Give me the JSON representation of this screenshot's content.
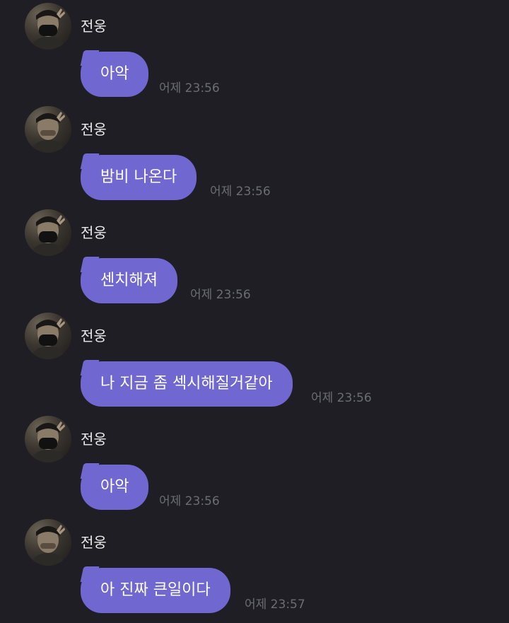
{
  "colors": {
    "background": "#1e1e24",
    "bubble": "#7068d0",
    "bubble_text": "#ffffff",
    "sender_text": "#ececec",
    "timestamp_text": "#6c6c74"
  },
  "messages": [
    {
      "sender": "전웅",
      "text": "아악",
      "time": "어제 23:56"
    },
    {
      "sender": "전웅",
      "text": "밤비 나온다",
      "time": "어제 23:56"
    },
    {
      "sender": "전웅",
      "text": "센치해져",
      "time": "어제 23:56"
    },
    {
      "sender": "전웅",
      "text": "나 지금 좀 섹시해질거같아",
      "time": "어제 23:56"
    },
    {
      "sender": "전웅",
      "text": "아악",
      "time": "어제 23:56"
    },
    {
      "sender": "전웅",
      "text": "아 진짜 큰일이다",
      "time": "어제 23:57"
    }
  ]
}
